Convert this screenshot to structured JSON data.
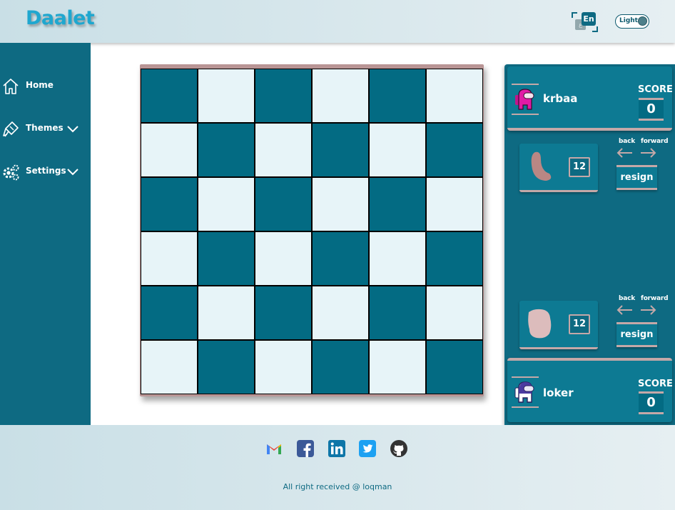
{
  "header": {
    "logo": "Daalet",
    "language": {
      "front": "En",
      "back": "ع"
    },
    "theme_toggle_label": "Light"
  },
  "sidebar": {
    "items": [
      {
        "label": "Home",
        "icon": "home-icon",
        "has_dropdown": false
      },
      {
        "label": "Themes",
        "icon": "paint-brush-icon",
        "has_dropdown": true
      },
      {
        "label": "Settings",
        "icon": "gears-icon",
        "has_dropdown": true
      }
    ]
  },
  "board": {
    "rows": 6,
    "cols": 6,
    "dark_color": "#036b83",
    "light_color": "#e7f4f8",
    "frame_color": "#b99595"
  },
  "players": {
    "top": {
      "name": "krbaa",
      "avatar": "pink-crewmate-icon",
      "score_label": "SCORE",
      "score": "0",
      "piece_count": "12",
      "piece_shape": "bean-piece",
      "back_label": "back",
      "forward_label": "forward",
      "resign_label": "resign"
    },
    "bottom": {
      "name": "loker",
      "avatar": "purple-crewmate-icon",
      "score_label": "SCORE",
      "score": "0",
      "piece_count": "12",
      "piece_shape": "blob-piece",
      "back_label": "back",
      "forward_label": "forward",
      "resign_label": "resign"
    }
  },
  "footer": {
    "social": [
      "gmail-icon",
      "facebook-icon",
      "linkedin-icon",
      "twitter-icon",
      "github-icon"
    ],
    "copyright": "All right received @ loqman"
  },
  "colors": {
    "primary": "#0e6a82",
    "accent": "#1fa7cf",
    "frame": "#c4a8a8"
  }
}
